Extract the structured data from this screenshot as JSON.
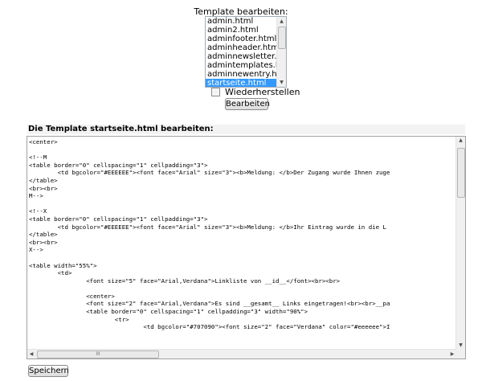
{
  "template_selector": {
    "title": "Template bearbeiten:",
    "options": [
      "admin.html",
      "admin2.html",
      "adminfooter.html",
      "adminheader.html",
      "adminnewsletter.html",
      "admintemplates.html",
      "adminnewentry.html",
      "startseite.html"
    ],
    "selected": "startseite.html",
    "restore_label": "Wiederherstellen",
    "edit_button": "Bearbeiten"
  },
  "editor": {
    "heading": "Die Template startseite.html bearbeiten:",
    "lines": [
      "<center>",
      "",
      "<!--M",
      "<table border=\"0\" cellspacing=\"1\" cellpadding=\"3\">",
      "        <td bgcolor=\"#EEEEEE\"><font face=\"Arial\" size=\"3\"><b>Meldung: </b>Der Zugang wurde Ihnen zuge",
      "</table>",
      "<br><br>",
      "M-->",
      "",
      "<!--X",
      "<table border=\"0\" cellspacing=\"1\" cellpadding=\"3\">",
      "        <td bgcolor=\"#EEEEEE\"><font face=\"Arial\" size=\"3\"><b>Meldung: </b>Ihr Eintrag wurde in die L",
      "</table>",
      "<br><br>",
      "X-->",
      "",
      "<table width=\"55%\">",
      "        <td>",
      "                <font size=\"5\" face=\"Arial,Verdana\">Linkliste von __id__</font><br><br>",
      "",
      "                <center>",
      "                <font size=\"2\" face=\"Arial,Verdana\">Es sind __gesamt__ Links eingetragen!<br><br>__pa",
      "                <table border=\"0\" cellspacing=\"1\" cellpadding=\"3\" width=\"90%\">",
      "                        <tr>",
      "                                <td bgcolor=\"#707090\"><font size=\"2\" face=\"Verdana\" color=\"#eeeeee\">I"
    ],
    "h_scroll_thumb_label": "III",
    "save_button": "Speichern"
  }
}
